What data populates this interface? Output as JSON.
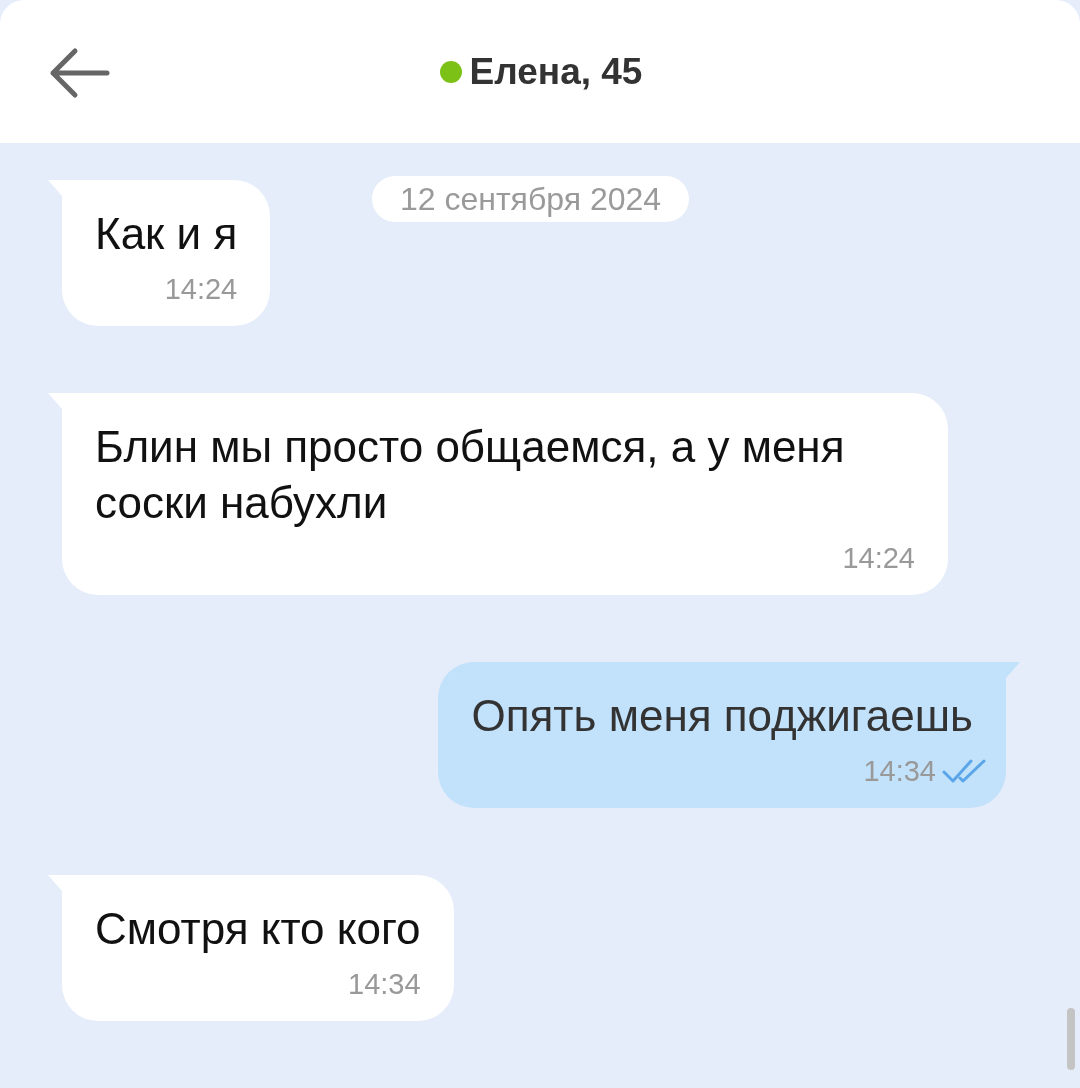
{
  "header": {
    "title": "Елена, 45",
    "online": true
  },
  "date_label": "12 сентября 2024",
  "messages": [
    {
      "kind": "incoming",
      "text": "Как и я",
      "time": "14:24"
    },
    {
      "kind": "incoming",
      "text": "Блин мы просто общаемся, а у меня соски набухли",
      "time": "14:24"
    },
    {
      "kind": "outgoing",
      "text": "Опять меня поджигаешь",
      "time": "14:34",
      "read": true
    },
    {
      "kind": "incoming",
      "text": "Смотря кто кого",
      "time": "14:34"
    }
  ]
}
